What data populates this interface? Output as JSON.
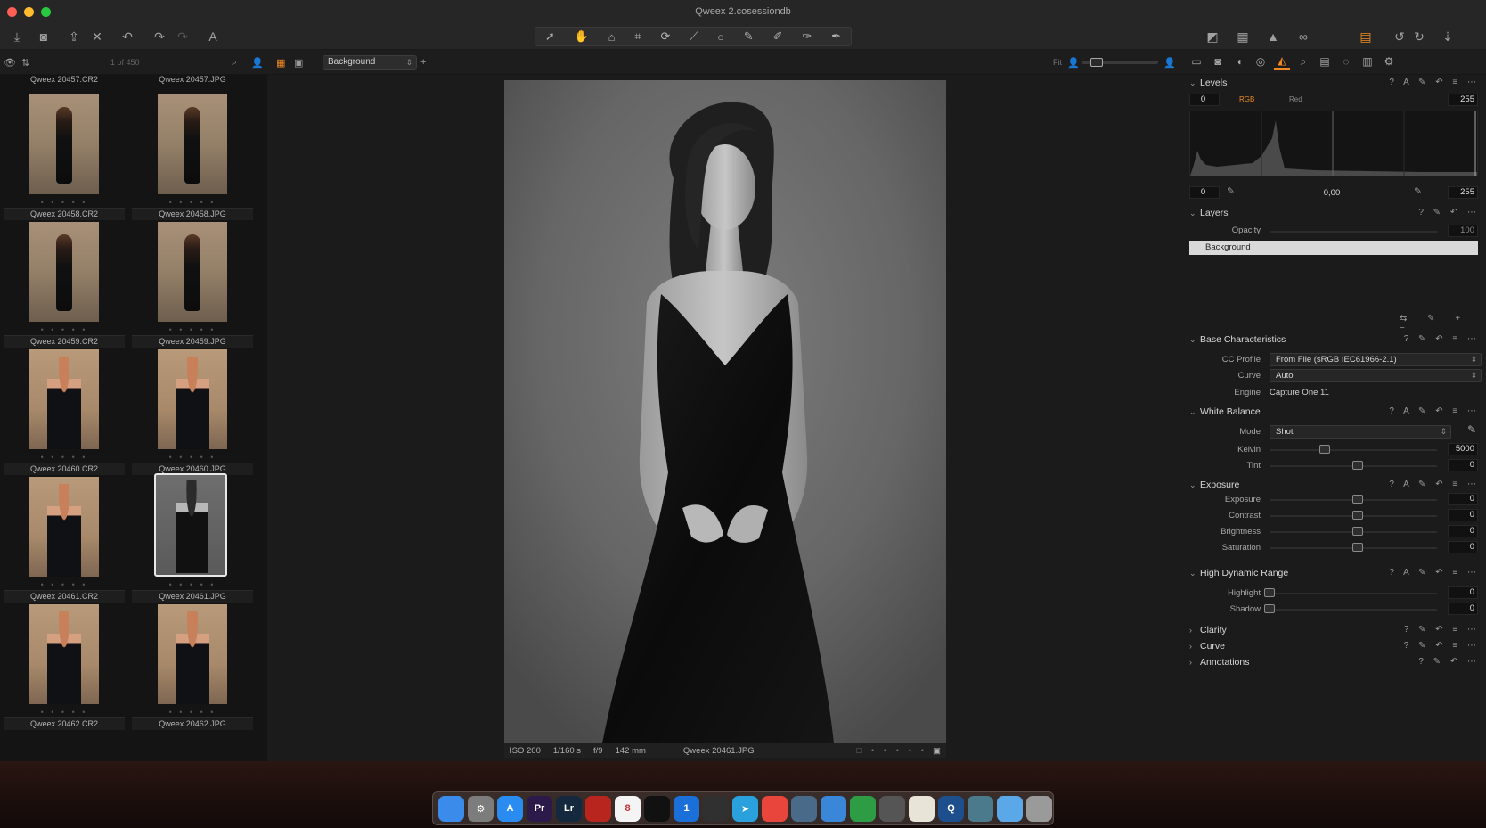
{
  "window": {
    "title": "Qweex 2.cosessiondb",
    "light_colors": [
      "#ff5f57",
      "#febc2e",
      "#28c840"
    ]
  },
  "toolbar": {
    "left_icons": [
      "import-icon",
      "camera-icon",
      "export-icon",
      "delete-icon",
      "undo-icon",
      "redo-icon",
      "redo-disabled-icon",
      "text-icon"
    ],
    "cursor_tools": [
      "select-tool-icon",
      "pan-tool-icon",
      "loupe-tool-icon",
      "crop-tool-icon",
      "rotate-tool-icon",
      "keystone-tool-icon",
      "spot-removal-tool-icon",
      "brush-tool-icon",
      "erase-tool-icon",
      "gradient-tool-icon",
      "annotation-tool-icon"
    ],
    "right_icons": [
      "compare-icon",
      "grid-icon",
      "exposure-warning-icon",
      "proof-glasses-icon",
      "copy-adjustments-icon",
      "reset-icon",
      "apply-icon",
      "sync-icon"
    ],
    "accent_color": "#f08a24"
  },
  "subbar": {
    "browser_count": "1 of 450",
    "layer_select": "Background",
    "fit_label": "Fit"
  },
  "browser": {
    "top_names": [
      "Qweex 20457.CR2",
      "Qweex 20457.JPG"
    ],
    "thumbnails": [
      {
        "name": "Qweex 20458.CR2",
        "style": "photo-warm"
      },
      {
        "name": "Qweex 20458.JPG",
        "style": "photo-warm"
      },
      {
        "name": "Qweex 20459.CR2",
        "style": "photo-warm"
      },
      {
        "name": "Qweex 20459.JPG",
        "style": "photo-warm"
      },
      {
        "name": "Qweex 20460.CR2",
        "style": "photo-color"
      },
      {
        "name": "Qweex 20460.JPG",
        "style": "photo-color"
      },
      {
        "name": "Qweex 20461.CR2",
        "style": "photo-color"
      },
      {
        "name": "Qweex 20461.JPG",
        "style": "photo-bw",
        "selected": true
      },
      {
        "name": "Qweex 20462.CR2",
        "style": "photo-color"
      },
      {
        "name": "Qweex 20462.JPG",
        "style": "photo-color"
      }
    ]
  },
  "viewer": {
    "meta": {
      "iso": "ISO 200",
      "shutter": "1/160 s",
      "aperture": "f/9",
      "focal": "142 mm",
      "filename": "Qweex 20461.JPG"
    }
  },
  "panel": {
    "levels": {
      "title": "Levels",
      "input_low": "0",
      "input_high": "255",
      "channel_rgb": "RGB",
      "channel_red": "Red",
      "output_low": "0",
      "midtone": "0,00",
      "output_high": "255"
    },
    "layers": {
      "title": "Layers",
      "opacity_label": "Opacity",
      "opacity_value": "100",
      "layer_name": "Background"
    },
    "base": {
      "title": "Base Characteristics",
      "icc_label": "ICC Profile",
      "icc_value": "From File (sRGB IEC61966-2.1)",
      "curve_label": "Curve",
      "curve_value": "Auto",
      "engine_label": "Engine",
      "engine_value": "Capture One 11"
    },
    "white_balance": {
      "title": "White Balance",
      "mode_label": "Mode",
      "mode_value": "Shot",
      "kelvin_label": "Kelvin",
      "kelvin_value": "5000",
      "tint_label": "Tint",
      "tint_value": "0"
    },
    "exposure": {
      "title": "Exposure",
      "rows": [
        {
          "label": "Exposure",
          "value": "0"
        },
        {
          "label": "Contrast",
          "value": "0"
        },
        {
          "label": "Brightness",
          "value": "0"
        },
        {
          "label": "Saturation",
          "value": "0"
        }
      ]
    },
    "hdr": {
      "title": "High Dynamic Range",
      "highlight_label": "Highlight",
      "highlight_value": "0",
      "shadow_label": "Shadow",
      "shadow_value": "0"
    },
    "collapsed": [
      "Clarity",
      "Curve",
      "Annotations"
    ]
  },
  "dock": {
    "apps": [
      {
        "name": "finder-icon",
        "label": "",
        "color": "#3b8bea"
      },
      {
        "name": "system-prefs-icon",
        "label": "⚙",
        "color": "#7c7c7c"
      },
      {
        "name": "app-store-icon",
        "label": "A",
        "color": "#2a8cf0"
      },
      {
        "name": "premiere-icon",
        "label": "Pr",
        "color": "#2b1a4a"
      },
      {
        "name": "lightroom-icon",
        "label": "Lr",
        "color": "#14293d"
      },
      {
        "name": "red-app-icon",
        "label": "",
        "color": "#b8241e"
      },
      {
        "name": "calendar-icon",
        "label": "8",
        "color": "#f4f4f4"
      },
      {
        "name": "capture-one-icon",
        "label": "",
        "color": "#111111"
      },
      {
        "name": "onepassword-icon",
        "label": "1",
        "color": "#1b6fd8"
      },
      {
        "name": "camera-app-icon",
        "label": "",
        "color": "#303030"
      },
      {
        "name": "telegram-icon",
        "label": "➤",
        "color": "#2aa0dc"
      },
      {
        "name": "chrome-icon",
        "label": "",
        "color": "#e8453c"
      },
      {
        "name": "preview-icon",
        "label": "",
        "color": "#4a6a8a"
      },
      {
        "name": "keynote-icon",
        "label": "",
        "color": "#3a86d8"
      },
      {
        "name": "numbers-icon",
        "label": "",
        "color": "#2e9b45"
      },
      {
        "name": "photo-booth-icon",
        "label": "",
        "color": "#555555"
      },
      {
        "name": "textedit-icon",
        "label": "",
        "color": "#e8e4d8"
      },
      {
        "name": "quicktime-icon",
        "label": "Q",
        "color": "#1d4f8c"
      },
      {
        "name": "downloads-icon",
        "label": "",
        "color": "#4b7a8c"
      },
      {
        "name": "folder-icon",
        "label": "",
        "color": "#5aa8e8"
      },
      {
        "name": "trash-icon",
        "label": "",
        "color": "#9a9a9a"
      }
    ]
  }
}
